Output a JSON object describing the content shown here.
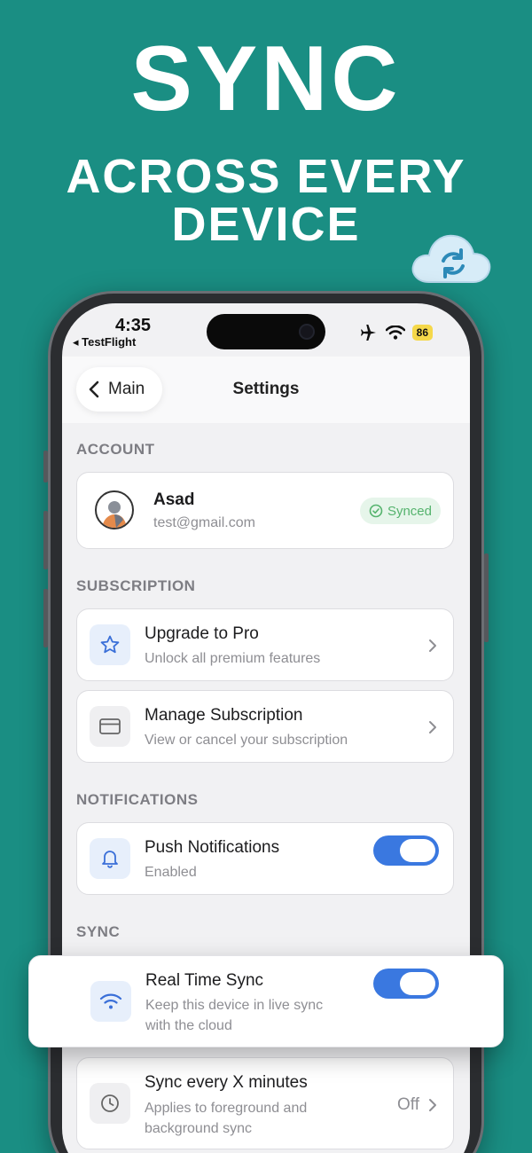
{
  "hero": {
    "title": "SYNC",
    "subtitle_line1": "ACROSS EVERY",
    "subtitle_line2": "DEVICE"
  },
  "status": {
    "time": "4:35",
    "back_app": "◂ TestFlight",
    "battery": "86"
  },
  "nav": {
    "back_label": "Main",
    "title": "Settings"
  },
  "account": {
    "section": "ACCOUNT",
    "name": "Asad",
    "email": "test@gmail.com",
    "badge": "Synced"
  },
  "subscription": {
    "section": "SUBSCRIPTION",
    "upgrade": {
      "title": "Upgrade to Pro",
      "subtitle": "Unlock all premium features"
    },
    "manage": {
      "title": "Manage Subscription",
      "subtitle": "View or cancel your subscription"
    }
  },
  "notifications": {
    "section": "NOTIFICATIONS",
    "push": {
      "title": "Push Notifications",
      "subtitle": "Enabled",
      "enabled": true
    }
  },
  "sync": {
    "section": "SYNC",
    "realtime": {
      "title": "Real Time Sync",
      "subtitle_line1": "Keep this device in live sync",
      "subtitle_line2": "with the cloud",
      "enabled": true
    },
    "interval": {
      "title": "Sync every X minutes",
      "subtitle_line1": "Applies to foreground and",
      "subtitle_line2": "background sync",
      "value": "Off"
    }
  },
  "colors": {
    "background": "#1a8e83",
    "accent": "#3a78e0",
    "synced": "#55b36d"
  }
}
